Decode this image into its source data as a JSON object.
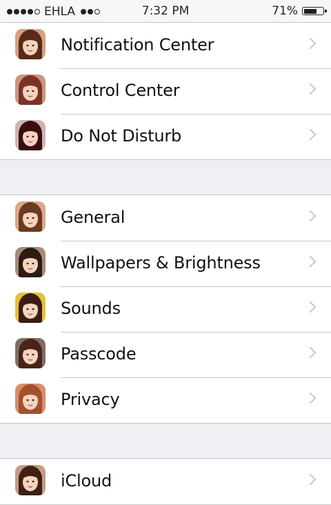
{
  "status_bar": {
    "carrier": "EHLA",
    "time": "7:32 PM",
    "battery_text": "71%",
    "battery_level": 0.71,
    "signal_filled": 4,
    "signal_total": 5
  },
  "groups": [
    {
      "rows": [
        {
          "label": "Notification Center",
          "avatar_bg": "#d8a07f",
          "avatar_hair": "#5a2a18",
          "avatar_icon": "profile-photo-icon"
        },
        {
          "label": "Control Center",
          "avatar_bg": "#c9977f",
          "avatar_hair": "#7c3326",
          "avatar_icon": "profile-photo-icon"
        },
        {
          "label": "Do Not Disturb",
          "avatar_bg": "#cfb4b0",
          "avatar_hair": "#3a0e10",
          "avatar_icon": "profile-photo-icon"
        }
      ]
    },
    {
      "rows": [
        {
          "label": "General",
          "avatar_bg": "#d9a98a",
          "avatar_hair": "#6b3a1f",
          "avatar_icon": "profile-photo-icon"
        },
        {
          "label": "Wallpapers & Brightness",
          "avatar_bg": "#a78b78",
          "avatar_hair": "#2d1a12",
          "avatar_icon": "profile-photo-icon"
        },
        {
          "label": "Sounds",
          "avatar_bg": "#e6c03a",
          "avatar_hair": "#3b1c12",
          "avatar_icon": "profile-photo-icon"
        },
        {
          "label": "Passcode",
          "avatar_bg": "#7d6e6a",
          "avatar_hair": "#4a2416",
          "avatar_icon": "profile-photo-icon"
        },
        {
          "label": "Privacy",
          "avatar_bg": "#d98c6c",
          "avatar_hair": "#a0522d",
          "avatar_icon": "profile-photo-icon"
        }
      ]
    },
    {
      "rows": [
        {
          "label": "iCloud",
          "avatar_bg": "#c99a84",
          "avatar_hair": "#3e2014",
          "avatar_icon": "profile-photo-icon"
        }
      ]
    }
  ]
}
